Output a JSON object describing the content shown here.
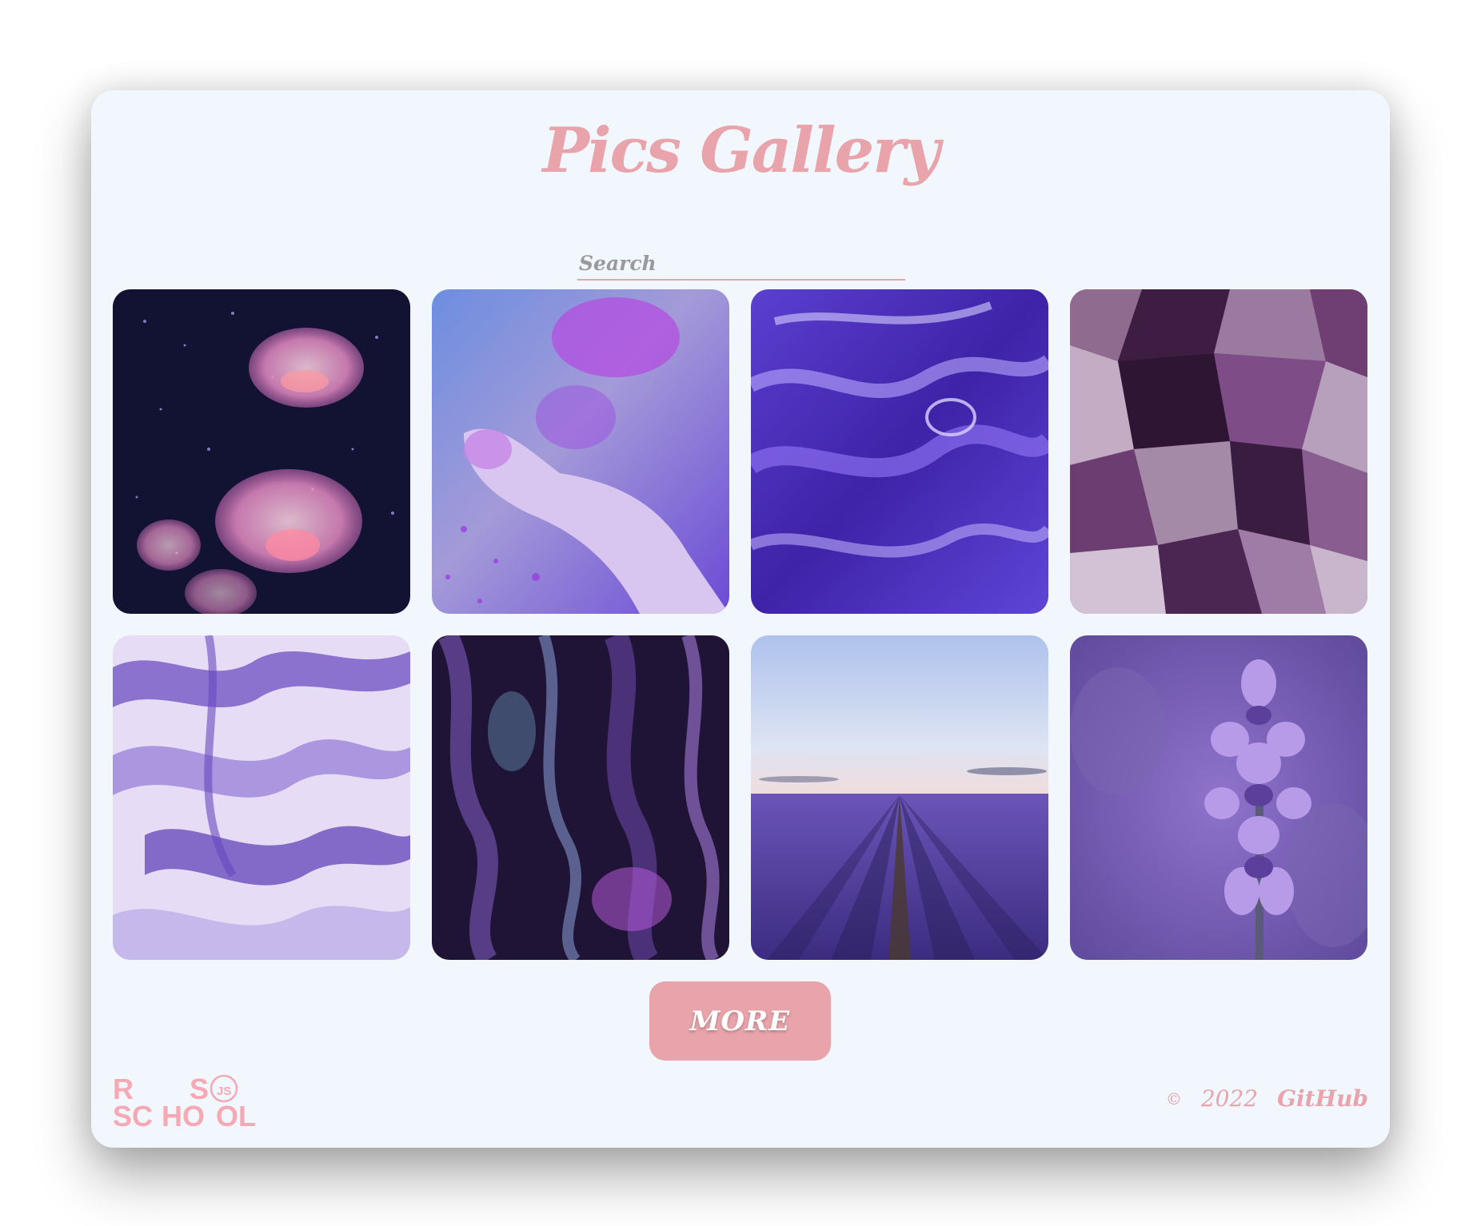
{
  "header": {
    "title": "Pics Gallery"
  },
  "search": {
    "placeholder": "Search",
    "value": ""
  },
  "gallery": {
    "images": [
      {
        "subject": "jellyfish"
      },
      {
        "subject": "purple powder hand"
      },
      {
        "subject": "violet liquid paint"
      },
      {
        "subject": "amethyst crystals"
      },
      {
        "subject": "lavender marble"
      },
      {
        "subject": "dark abstract paint"
      },
      {
        "subject": "lavender field"
      },
      {
        "subject": "lavender flower"
      }
    ]
  },
  "actions": {
    "more_label": "MORE"
  },
  "footer": {
    "logo_text": "RS SCHOOL",
    "copyright_symbol": "©",
    "year": "2022",
    "github_label": "GitHub"
  },
  "colors": {
    "accent": "#e8a3ab",
    "background": "#f1f7fd"
  }
}
